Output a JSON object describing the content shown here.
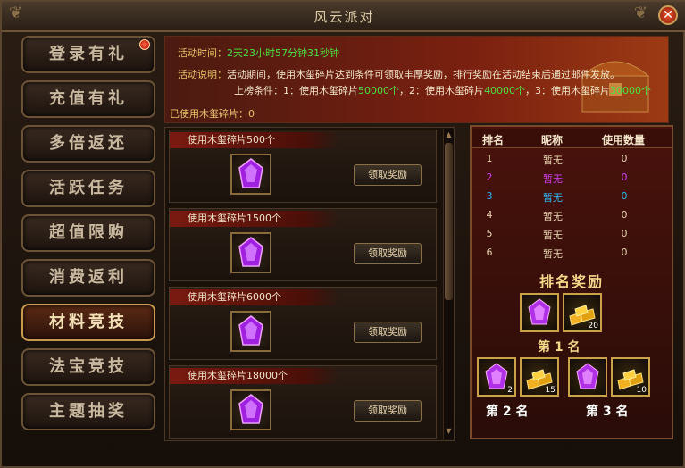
{
  "window": {
    "title": "风云派对",
    "close_label": "✕"
  },
  "sidebar": {
    "items": [
      {
        "label": "登录有礼"
      },
      {
        "label": "充值有礼"
      },
      {
        "label": "多倍返还"
      },
      {
        "label": "活跃任务"
      },
      {
        "label": "超值限购"
      },
      {
        "label": "消费返利"
      },
      {
        "label": "材料竞技"
      },
      {
        "label": "法宝竞技"
      },
      {
        "label": "主题抽奖"
      }
    ],
    "active_index": 6
  },
  "banner": {
    "time_label": "活动时间：",
    "time_value": "2天23小时57分钟31秒钟",
    "desc_label": "活动说明：",
    "desc_text": "活动期间，使用木玺碎片达到条件可领取丰厚奖励，排行奖励在活动结束后通过邮件发放。",
    "cond_prefix": "上榜条件：1：使用木玺碎片",
    "cond1": "50000个",
    "cond_mid1": "，2：使用木玺碎片",
    "cond2": "40000个",
    "cond_mid2": "，3：使用木玺碎片",
    "cond3": "30000个",
    "used_label": "已使用木玺碎片：0"
  },
  "rewards": [
    {
      "title": "使用木玺碎片500个",
      "button": "领取奖励"
    },
    {
      "title": "使用木玺碎片1500个",
      "button": "领取奖励"
    },
    {
      "title": "使用木玺碎片6000个",
      "button": "领取奖励"
    },
    {
      "title": "使用木玺碎片18000个",
      "button": "领取奖励"
    }
  ],
  "ranking": {
    "headers": {
      "rank": "排名",
      "name": "昵称",
      "amount": "使用数量"
    },
    "rows": [
      {
        "rank": "1",
        "name": "暂无",
        "amount": "0",
        "color": "#e8d6b0"
      },
      {
        "rank": "2",
        "name": "暂无",
        "amount": "0",
        "color": "#d040f0"
      },
      {
        "rank": "3",
        "name": "暂无",
        "amount": "0",
        "color": "#30b8f0"
      },
      {
        "rank": "4",
        "name": "暂无",
        "amount": "0",
        "color": "#e8d6b0"
      },
      {
        "rank": "5",
        "name": "暂无",
        "amount": "0",
        "color": "#e8d6b0"
      },
      {
        "rank": "6",
        "name": "暂无",
        "amount": "0",
        "color": "#e8d6b0"
      }
    ],
    "reward_title": "排名奖励",
    "first": {
      "label": "第 1 名",
      "items": [
        {
          "icon": "purple-gem-icon",
          "qty": ""
        },
        {
          "icon": "gold-bars-icon",
          "qty": "20"
        }
      ]
    },
    "second": {
      "label": "第 2 名",
      "items": [
        {
          "icon": "purple-gem-icon",
          "qty": "2"
        },
        {
          "icon": "gold-bars-icon",
          "qty": "15"
        }
      ]
    },
    "third": {
      "label": "第 3 名",
      "items": [
        {
          "icon": "purple-gem-icon",
          "qty": ""
        },
        {
          "icon": "gold-bars-icon",
          "qty": "10"
        }
      ]
    }
  }
}
